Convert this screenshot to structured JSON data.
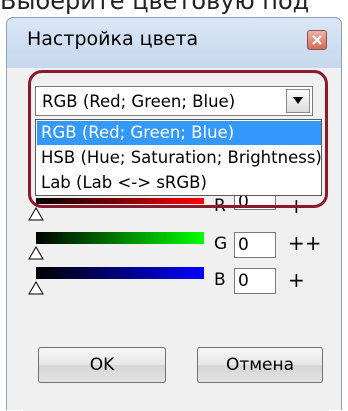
{
  "page": {
    "header_text": "Выберите цветовую под"
  },
  "window": {
    "title": "Настройка цвета"
  },
  "color_model": {
    "selected": "RGB (Red; Green; Blue)",
    "options": [
      "RGB (Red; Green; Blue)",
      "HSB (Hue; Saturation; Brightness)",
      "Lab (Lab <-> sRGB)"
    ]
  },
  "channels": [
    {
      "label": "R",
      "value": "0",
      "sign": "+"
    },
    {
      "label": "G",
      "value": "0",
      "sign": "++"
    },
    {
      "label": "B",
      "value": "0",
      "sign": "+"
    }
  ],
  "buttons": {
    "ok": "OK",
    "cancel": "Отмена"
  },
  "colors": {
    "highlight": "#8b1a2e",
    "selection": "#3399ff",
    "title_bar": "#c6d8ee"
  }
}
